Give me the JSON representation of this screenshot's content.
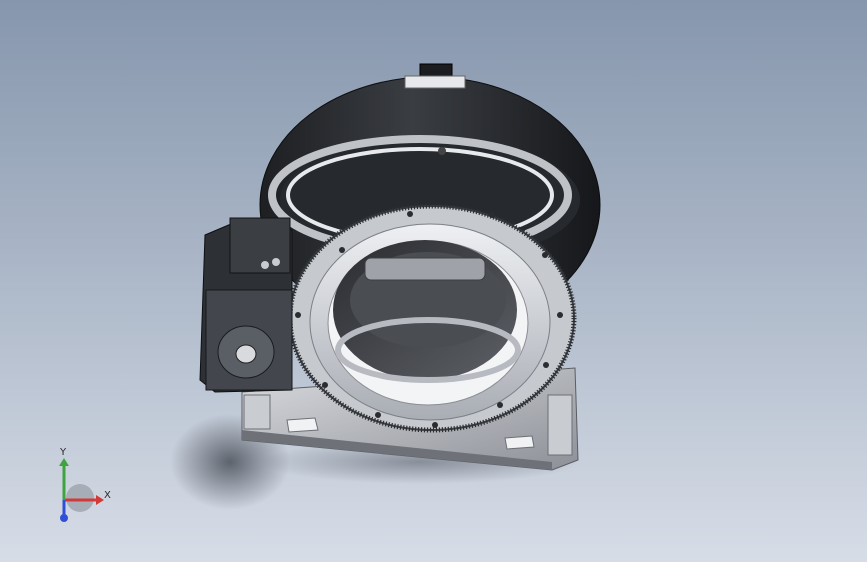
{
  "view": {
    "background_top": "#8696ad",
    "background_bottom": "#d7dde7",
    "model": "rotary-table-assembly"
  },
  "triad": {
    "x_label": "X",
    "y_label": "Y",
    "x_color": "#d23a3a",
    "y_color": "#3fa33f",
    "z_color": "#2f4fd6"
  }
}
